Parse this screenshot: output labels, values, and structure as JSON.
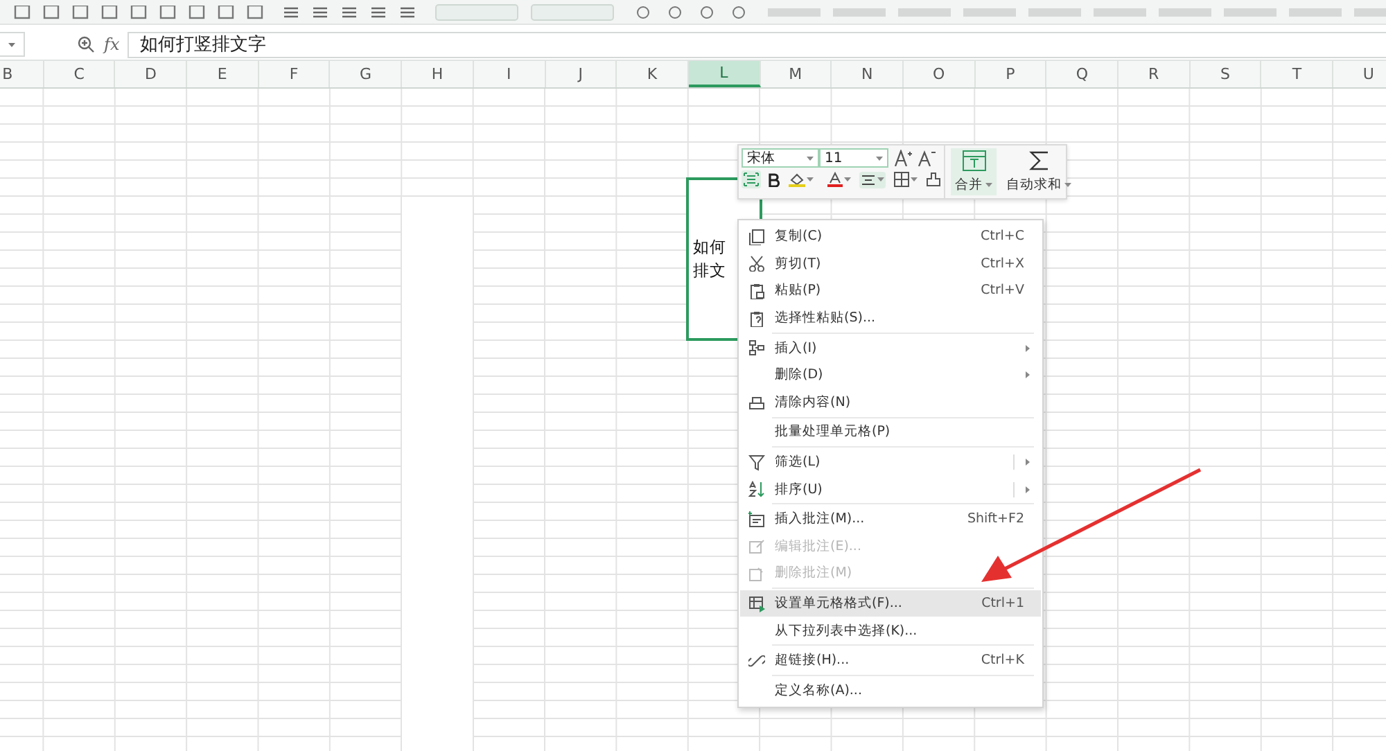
{
  "formula_bar": {
    "fx": "fx",
    "value": "如何打竖排文字"
  },
  "columns": [
    {
      "label": "B",
      "selected": false
    },
    {
      "label": "C",
      "selected": false
    },
    {
      "label": "D",
      "selected": false
    },
    {
      "label": "E",
      "selected": false
    },
    {
      "label": "F",
      "selected": false
    },
    {
      "label": "G",
      "selected": false
    },
    {
      "label": "H",
      "selected": false
    },
    {
      "label": "I",
      "selected": false
    },
    {
      "label": "J",
      "selected": false
    },
    {
      "label": "K",
      "selected": false
    },
    {
      "label": "L",
      "selected": true
    },
    {
      "label": "M",
      "selected": false
    },
    {
      "label": "N",
      "selected": false
    },
    {
      "label": "O",
      "selected": false
    },
    {
      "label": "P",
      "selected": false
    },
    {
      "label": "Q",
      "selected": false
    },
    {
      "label": "R",
      "selected": false
    },
    {
      "label": "S",
      "selected": false
    },
    {
      "label": "T",
      "selected": false
    },
    {
      "label": "U",
      "selected": false
    }
  ],
  "active_cell": {
    "lines": [
      "如何",
      "排文"
    ]
  },
  "mini_toolbar": {
    "font": "宋体",
    "size": "11",
    "merge": "合并",
    "autosum": "自动求和"
  },
  "context_menu": [
    {
      "kind": "item",
      "label": "复制(C)",
      "shortcut": "Ctrl+C",
      "disabled": false,
      "selected": false,
      "submenu": false
    },
    {
      "kind": "item",
      "label": "剪切(T)",
      "shortcut": "Ctrl+X",
      "disabled": false,
      "selected": false,
      "submenu": false
    },
    {
      "kind": "item",
      "label": "粘贴(P)",
      "shortcut": "Ctrl+V",
      "disabled": false,
      "selected": false,
      "submenu": false
    },
    {
      "kind": "item",
      "label": "选择性粘贴(S)...",
      "disabled": false,
      "selected": false,
      "submenu": false
    },
    {
      "kind": "separator"
    },
    {
      "kind": "item",
      "label": "插入(I)",
      "disabled": false,
      "selected": false,
      "submenu": true
    },
    {
      "kind": "item",
      "label": "删除(D)",
      "disabled": false,
      "selected": false,
      "submenu": true
    },
    {
      "kind": "item",
      "label": "清除内容(N)",
      "disabled": false,
      "selected": false,
      "submenu": false
    },
    {
      "kind": "separator"
    },
    {
      "kind": "item",
      "label": "批量处理单元格(P)",
      "disabled": false,
      "selected": false,
      "submenu": false
    },
    {
      "kind": "separator"
    },
    {
      "kind": "split",
      "label": "筛选(L)",
      "disabled": false,
      "selected": false,
      "submenu": true
    },
    {
      "kind": "split",
      "label": "排序(U)",
      "disabled": false,
      "selected": false,
      "submenu": true
    },
    {
      "kind": "separator"
    },
    {
      "kind": "item",
      "label": "插入批注(M)...",
      "shortcut": "Shift+F2",
      "disabled": false,
      "selected": false,
      "submenu": false
    },
    {
      "kind": "item",
      "label": "编辑批注(E)...",
      "disabled": true,
      "selected": false,
      "submenu": false
    },
    {
      "kind": "item",
      "label": "删除批注(M)",
      "disabled": true,
      "selected": false,
      "submenu": false
    },
    {
      "kind": "separator"
    },
    {
      "kind": "item",
      "label": "设置单元格格式(F)...",
      "shortcut": "Ctrl+1",
      "disabled": false,
      "selected": true,
      "submenu": false
    },
    {
      "kind": "item",
      "label": "从下拉列表中选择(K)...",
      "disabled": false,
      "selected": false,
      "submenu": false
    },
    {
      "kind": "separator"
    },
    {
      "kind": "item",
      "label": "超链接(H)...",
      "shortcut": "Ctrl+K",
      "disabled": false,
      "selected": false,
      "submenu": false
    },
    {
      "kind": "separator"
    },
    {
      "kind": "item",
      "label": "定义名称(A)...",
      "disabled": false,
      "selected": false,
      "submenu": false
    }
  ]
}
